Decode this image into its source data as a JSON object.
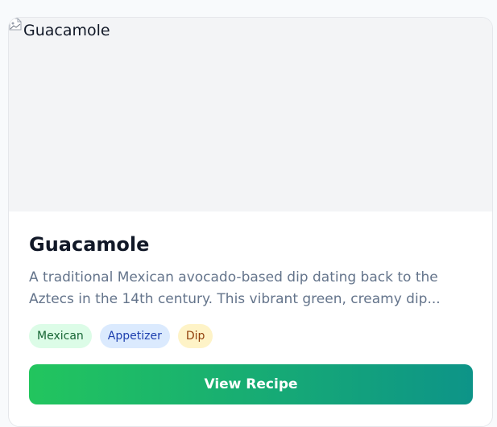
{
  "recipe": {
    "image_alt": "Guacamole",
    "title": "Guacamole",
    "description": "A traditional Mexican avocado-based dip dating back to the Aztecs in the 14th century. This vibrant green, creamy dip...",
    "tags": [
      "Mexican",
      "Appetizer",
      "Dip"
    ],
    "button_label": "View Recipe"
  },
  "icons": {
    "broken_image": "broken-image-icon"
  },
  "colors": {
    "button_gradient_start": "#22c55e",
    "button_gradient_end": "#0d9488",
    "tag_mexican_bg": "#dcfce7",
    "tag_appetizer_bg": "#dbeafe",
    "tag_dip_bg": "#fef3c7"
  }
}
